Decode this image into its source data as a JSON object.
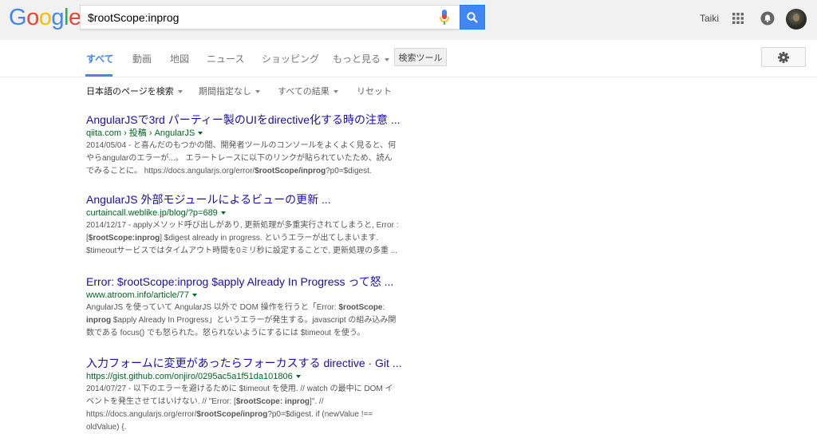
{
  "header": {
    "logo_letters": [
      {
        "ch": "G",
        "color": "#4285f4"
      },
      {
        "ch": "o",
        "color": "#ea4335"
      },
      {
        "ch": "o",
        "color": "#fbbc05"
      },
      {
        "ch": "g",
        "color": "#4285f4"
      },
      {
        "ch": "l",
        "color": "#34a853"
      },
      {
        "ch": "e",
        "color": "#ea4335"
      }
    ],
    "search_query": "$rootScope:inprog",
    "user_name": "Taiki"
  },
  "tabs": {
    "items": [
      "すべて",
      "動画",
      "地図",
      "ニュース",
      "ショッピング",
      "もっと見る"
    ],
    "tools_label": "検索ツール"
  },
  "filters": [
    "日本語のページを検索",
    "期間指定なし",
    "すべての結果",
    "リセット"
  ],
  "results": [
    {
      "title": "AngularJSで3rd パーティー製のUIをdirective化する時の注意 ...",
      "url": "qiita.com › 投稿 › AngularJS",
      "snippet": [
        [
          {
            "t": "2014/05/04 - と喜んだのもつかの間、開発者ツールのコンソールをよくよく見ると、何"
          }
        ],
        [
          {
            "t": "やらangularのエラーが...。 エラートレースに以下のリンクが貼られていたため、読ん"
          }
        ],
        [
          {
            "t": "でみることに。 https://docs.angularjs.org/error/"
          },
          {
            "t": "$rootScope/inprog",
            "b": true
          },
          {
            "t": "?p0=$digest."
          }
        ]
      ]
    },
    {
      "title": "AngularJS 外部モジュールによるビューの更新 ...",
      "url": "curtaincall.weblike.jp/blog/?p=689",
      "snippet": [
        [
          {
            "t": "2014/12/17 - applyメソッド呼び出しがあり, 更新処理が多重実行されてしまうと, Error :"
          }
        ],
        [
          {
            "t": "["
          },
          {
            "t": "$rootScope:inprog",
            "b": true
          },
          {
            "t": "] $digest already in progress. というエラーが出てしまいます."
          }
        ],
        [
          {
            "t": "$timeoutサービスではタイムアウト時間を0ミリ秒に設定することで, 更新処理の多重 ..."
          }
        ]
      ]
    },
    {
      "title": "Error: $rootScope:inprog $apply Already In Progress って怒 ...",
      "url": "www.atroom.info/article/77",
      "snippet": [
        [
          {
            "t": "AngularJS を使っていて AngularJS 以外で DOM 操作を行うと「Error: "
          },
          {
            "t": "$rootScope",
            "b": true
          },
          {
            "t": ":"
          }
        ],
        [
          {
            "t": "inprog",
            "b": true
          },
          {
            "t": " $apply Already In Progress」というエラーが発生する。javascript の組み込み関"
          }
        ],
        [
          {
            "t": "数である focus() でも怒られた。怒られないようにするには $timeout を使う。"
          }
        ]
      ]
    },
    {
      "title": "入力フォームに変更があったらフォーカスする directive · Git ...",
      "url": "https://gist.github.com/onjiro/0295ac5a1f51da101806",
      "snippet": [
        [
          {
            "t": "2014/07/27 - 以下のエラーを避けるために $timeout を使用. // watch の最中に DOM イ"
          }
        ],
        [
          {
            "t": "ベントを発生させてはいけない. // \"Error: ["
          },
          {
            "t": "$rootScope: inprog",
            "b": true
          },
          {
            "t": "]\". //"
          }
        ],
        [
          {
            "t": "https://docs.angularjs.org/error/"
          },
          {
            "t": "$rootScope/inprog",
            "b": true
          },
          {
            "t": "?p0=$digest. if (newValue !=="
          }
        ],
        [
          {
            "t": "oldValue) {."
          }
        ]
      ]
    }
  ]
}
